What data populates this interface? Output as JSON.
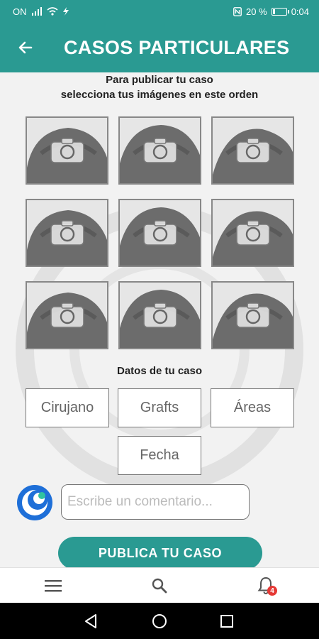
{
  "status_bar": {
    "left_text": "ON",
    "battery_percent": "20 %",
    "battery_level": 0.2,
    "time": "0:04"
  },
  "app_bar": {
    "title": "CASOS PARTICULARES",
    "back_icon": "arrow-left-icon"
  },
  "instructions": {
    "line1": "Para publicar tu caso",
    "line2": "selecciona tus imágenes en este orden"
  },
  "photo_slots": [
    {
      "icon": "camera-icon"
    },
    {
      "icon": "camera-icon"
    },
    {
      "icon": "camera-icon"
    },
    {
      "icon": "camera-icon"
    },
    {
      "icon": "camera-icon"
    },
    {
      "icon": "camera-icon"
    },
    {
      "icon": "camera-icon"
    },
    {
      "icon": "camera-icon"
    },
    {
      "icon": "camera-icon"
    }
  ],
  "case_data": {
    "title": "Datos de tu caso",
    "surgeon": "Cirujano",
    "grafts": "Grafts",
    "areas": "Áreas",
    "date": "Fecha"
  },
  "comment": {
    "placeholder": "Escribe un comentario..."
  },
  "publish": {
    "label": "PUBLICA TU CASO"
  },
  "bottom_nav": {
    "menu_icon": "menu-icon",
    "search_icon": "search-icon",
    "notifications_icon": "bell-icon",
    "notification_count": "4"
  },
  "colors": {
    "primary": "#2a9a92",
    "badge": "#e53935"
  }
}
